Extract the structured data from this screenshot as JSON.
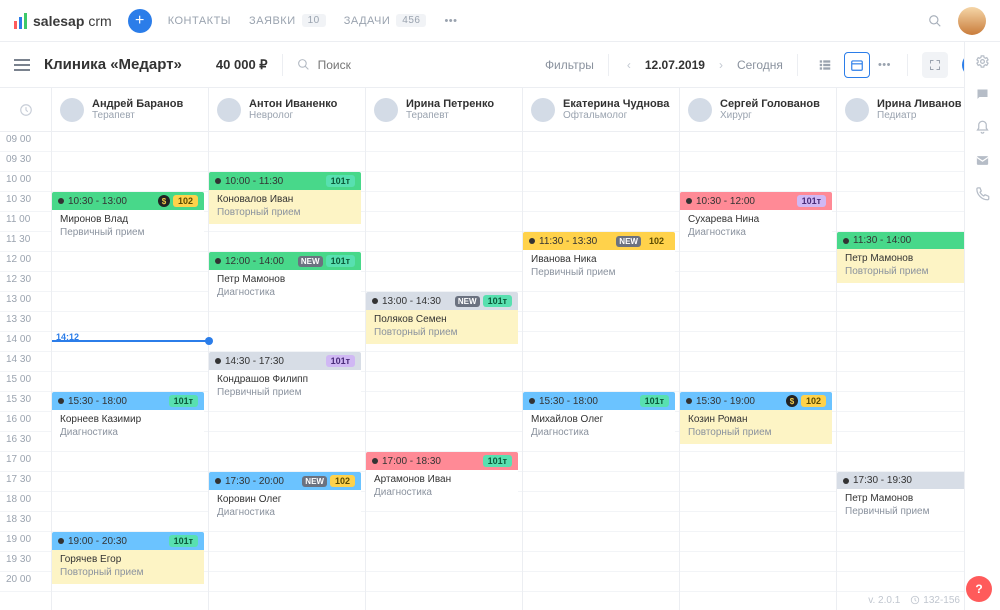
{
  "brand": {
    "name_a": "salesap",
    "name_b": "crm"
  },
  "nav": {
    "contacts": "КОНТАКТЫ",
    "requests": "ЗАЯВКИ",
    "requests_count": "10",
    "tasks": "ЗАДАЧИ",
    "tasks_count": "456"
  },
  "toolbar": {
    "title": "Клиника «Медарт»",
    "price": "40 000 ₽",
    "search_ph": "Поиск",
    "filters": "Фильтры",
    "date": "12.07.2019",
    "today": "Сегодня"
  },
  "time_axis": {
    "start_min": 540,
    "labels": [
      "09 00",
      "09 30",
      "10 00",
      "10 30",
      "11 00",
      "11 30",
      "12 00",
      "12 30",
      "13 00",
      "13 30",
      "14 00",
      "14 30",
      "15 00",
      "15 30",
      "16 00",
      "16 30",
      "17 00",
      "17 30",
      "18 00",
      "18 30",
      "19 00",
      "19 30",
      "20 00"
    ],
    "now": {
      "label": "14:12",
      "min": 852
    }
  },
  "columns": [
    {
      "name": "Андрей Баранов",
      "role": "Терапевт"
    },
    {
      "name": "Антон Иваненко",
      "role": "Невролог"
    },
    {
      "name": "Ирина Петренко",
      "role": "Терапевт"
    },
    {
      "name": "Екатерина Чуднова",
      "role": "Офтальмолог"
    },
    {
      "name": "Сергей Голованов",
      "role": "Хирург"
    },
    {
      "name": "Ирина Ливанов",
      "role": "Педиатр"
    }
  ],
  "events": [
    {
      "col": 0,
      "start": 630,
      "end": 780,
      "hdr_bg": "#48d88a",
      "time": "10:30 - 13:00",
      "tag": "102",
      "tag_bg": "#ffd24b",
      "tag_fg": "#5a4a00",
      "patient": "Миронов Влад",
      "kind": "Первичный прием",
      "coin": true,
      "body": "plain"
    },
    {
      "col": 0,
      "start": 930,
      "end": 1080,
      "hdr_bg": "#6bc3ff",
      "time": "15:30 - 18:00",
      "tag": "101т",
      "tag_bg": "#58e0b0",
      "tag_fg": "#0c5a3a",
      "patient": "Корнеев Казимир",
      "kind": "Диагностика",
      "body": "plain"
    },
    {
      "col": 0,
      "start": 1140,
      "end": 1230,
      "hdr_bg": "#6bc3ff",
      "time": "19:00 - 20:30",
      "tag": "101т",
      "tag_bg": "#58e0b0",
      "tag_fg": "#0c5a3a",
      "patient": "Горячев Егор",
      "kind": "Повторный прием",
      "body": "yellow"
    },
    {
      "col": 1,
      "start": 600,
      "end": 690,
      "hdr_bg": "#48d88a",
      "time": "10:00 - 11:30",
      "tag": "101т",
      "tag_bg": "#58e0b0",
      "tag_fg": "#0c5a3a",
      "patient": "Коновалов Иван",
      "kind": "Повторный прием",
      "body": "yellow"
    },
    {
      "col": 1,
      "start": 720,
      "end": 840,
      "hdr_bg": "#48d88a",
      "time": "12:00 - 14:00",
      "tag": "101т",
      "tag_bg": "#58e0b0",
      "tag_fg": "#0c5a3a",
      "patient": "Петр Мамонов",
      "kind": "Диагностика",
      "new": true,
      "body": "plain"
    },
    {
      "col": 1,
      "start": 870,
      "end": 1050,
      "hdr_bg": "#d7dde6",
      "time": "14:30 - 17:30",
      "tag": "101т",
      "tag_bg": "#d0b8f4",
      "tag_fg": "#4a2d7a",
      "patient": "Кондрашов Филипп",
      "kind": "Первичный прием",
      "body": "plain"
    },
    {
      "col": 1,
      "start": 1050,
      "end": 1200,
      "hdr_bg": "#6bc3ff",
      "time": "17:30 - 20:00",
      "tag": "102",
      "tag_bg": "#ffd24b",
      "tag_fg": "#5a4a00",
      "patient": "Коровин Олег",
      "kind": "Диагностика",
      "new": true,
      "body": "plain"
    },
    {
      "col": 2,
      "start": 780,
      "end": 870,
      "hdr_bg": "#d7dde6",
      "time": "13:00 - 14:30",
      "tag": "101т",
      "tag_bg": "#58e0b0",
      "tag_fg": "#0c5a3a",
      "patient": "Поляков Семен",
      "kind": "Повторный прием",
      "new": true,
      "body": "yellow"
    },
    {
      "col": 2,
      "start": 1020,
      "end": 1110,
      "hdr_bg": "#ff8a96",
      "time": "17:00 - 18:30",
      "tag": "101т",
      "tag_bg": "#58e0b0",
      "tag_fg": "#0c5a3a",
      "patient": "Артамонов Иван",
      "kind": "Диагностика",
      "body": "plain"
    },
    {
      "col": 3,
      "start": 690,
      "end": 810,
      "hdr_bg": "#ffd24b",
      "time": "11:30 - 13:30",
      "tag": "102",
      "tag_bg": "#ffd24b",
      "tag_fg": "#5a4a00",
      "patient": "Иванова Ника",
      "kind": "Первичный прием",
      "new": true,
      "body": "plain"
    },
    {
      "col": 3,
      "start": 930,
      "end": 1080,
      "hdr_bg": "#6bc3ff",
      "time": "15:30 - 18:00",
      "tag": "101т",
      "tag_bg": "#58e0b0",
      "tag_fg": "#0c5a3a",
      "patient": "Михайлов Олег",
      "kind": "Диагностика",
      "body": "plain"
    },
    {
      "col": 4,
      "start": 630,
      "end": 720,
      "hdr_bg": "#ff8a96",
      "time": "10:30 - 12:00",
      "tag": "101т",
      "tag_bg": "#d0b8f4",
      "tag_fg": "#4a2d7a",
      "patient": "Сухарева Нина",
      "kind": "Диагностика",
      "body": "plain"
    },
    {
      "col": 4,
      "start": 930,
      "end": 1140,
      "hdr_bg": "#6bc3ff",
      "time": "15:30 - 19:00",
      "tag": "102",
      "tag_bg": "#ffd24b",
      "tag_fg": "#5a4a00",
      "patient": "Козин Роман",
      "kind": "Повторный прием",
      "coin": true,
      "body": "yellow"
    },
    {
      "col": 5,
      "start": 690,
      "end": 840,
      "hdr_bg": "#48d88a",
      "time": "11:30 - 14:00",
      "tag": "",
      "patient": "Петр Мамонов",
      "kind": "Повторный прием",
      "body": "yellow"
    },
    {
      "col": 5,
      "start": 1050,
      "end": 1170,
      "hdr_bg": "#d7dde6",
      "time": "17:30 - 19:30",
      "tag": "",
      "patient": "Петр Мамонов",
      "kind": "Первичный прием",
      "body": "plain"
    }
  ],
  "footer": {
    "version": "v. 2.0.1",
    "range": "132-156"
  }
}
